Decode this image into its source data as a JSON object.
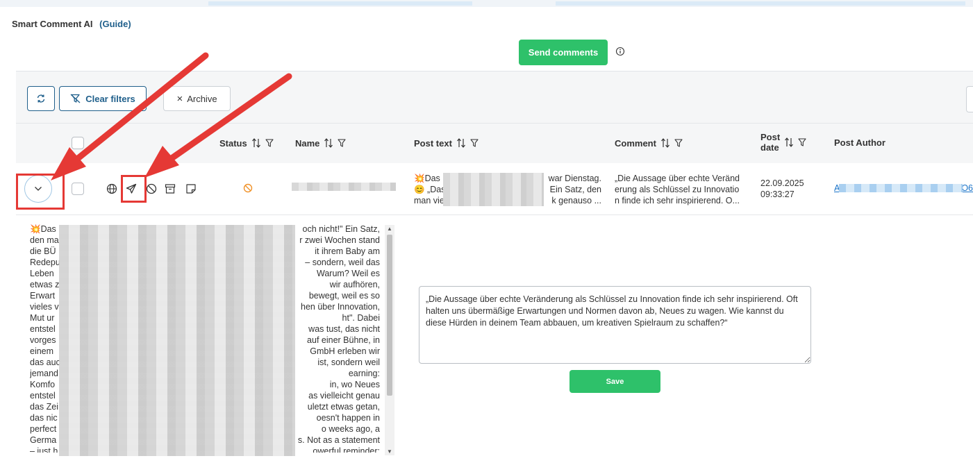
{
  "app": {
    "title": "Smart Comment AI",
    "guide_label": "(Guide)"
  },
  "actions": {
    "send_comments_label": "Send comments"
  },
  "toolbar": {
    "clear_filters_label": "Clear filters",
    "archive_label": "Archive"
  },
  "table": {
    "columns": {
      "status": "Status",
      "name": "Name",
      "post_text": "Post text",
      "comment": "Comment",
      "post_date_line1": "Post",
      "post_date_line2": "date",
      "post_author": "Post Author"
    },
    "row": {
      "post_text_line1_start": "💥Das",
      "post_text_line1_end": "war Dienstag.",
      "post_text_line2_start": "😊 „Das",
      "post_text_line2_end": "Ein Satz, den",
      "post_text_line3_start": "man vie",
      "post_text_line3_end": "k genauso ...",
      "comment_preview": "„Die Aussage über echte Veränd erung als Schlüssel zu Innovatio n finde ich sehr inspirierend. O...",
      "date": "22.09.2025",
      "time": "09:33:27",
      "author_start": "A",
      "author_end": "O6"
    }
  },
  "detail": {
    "post_lines": [
      [
        "💥Das",
        "och nicht!\" Ein Satz,"
      ],
      [
        "den ma",
        "r zwei Wochen stand"
      ],
      [
        "die BÜ",
        "it ihrem Baby am"
      ],
      [
        "Redepu",
        "– sondern, weil das"
      ],
      [
        "Leben",
        "Warum? Weil es"
      ],
      [
        "etwas z",
        "wir aufhören,"
      ],
      [
        "Erwart",
        "bewegt, weil es so"
      ],
      [
        "vieles v",
        "hen über Innovation,"
      ],
      [
        "Mut ur",
        "ht\". Dabei"
      ],
      [
        "entstel",
        "was tust, das nicht"
      ],
      [
        "vorges",
        "auf einer Bühne, in"
      ],
      [
        "einem",
        "GmbH erleben wir"
      ],
      [
        "das auc",
        "ist, sondern weil"
      ],
      [
        "jemand",
        "earning:"
      ],
      [
        "Komfo",
        "in, wo Neues"
      ],
      [
        "entstel",
        "as vielleicht genau"
      ],
      [
        "das Zei",
        "uletzt etwas getan,"
      ],
      [
        "das nic",
        "oesn't happen in"
      ],
      [
        "perfect",
        "o weeks ago, a"
      ],
      [
        "Germa",
        "s. Not as a statement"
      ],
      [
        "– just h",
        "owerful reminder:"
      ]
    ],
    "comment_text": "„Die Aussage über echte Veränderung als Schlüssel zu Innovation finde ich sehr inspirierend. Oft halten uns übermäßige Erwartungen und Normen davon ab, Neues zu wagen. Wie kannst du diese Hürden in deinem Team abbauen, um kreativen Spielraum zu schaffen?“",
    "save_label": "Save"
  },
  "colors": {
    "accent_green": "#2ec16a",
    "primary_blue": "#1f5f8b",
    "annotation_red": "#e53935",
    "status_orange": "#f0932b"
  },
  "icons": [
    "refresh-icon",
    "filter-clear-icon",
    "close-icon",
    "info-icon",
    "chevron-down-icon",
    "globe-icon",
    "send-icon",
    "ban-icon",
    "archive-icon",
    "note-icon",
    "sort-icon",
    "filter-icon"
  ]
}
